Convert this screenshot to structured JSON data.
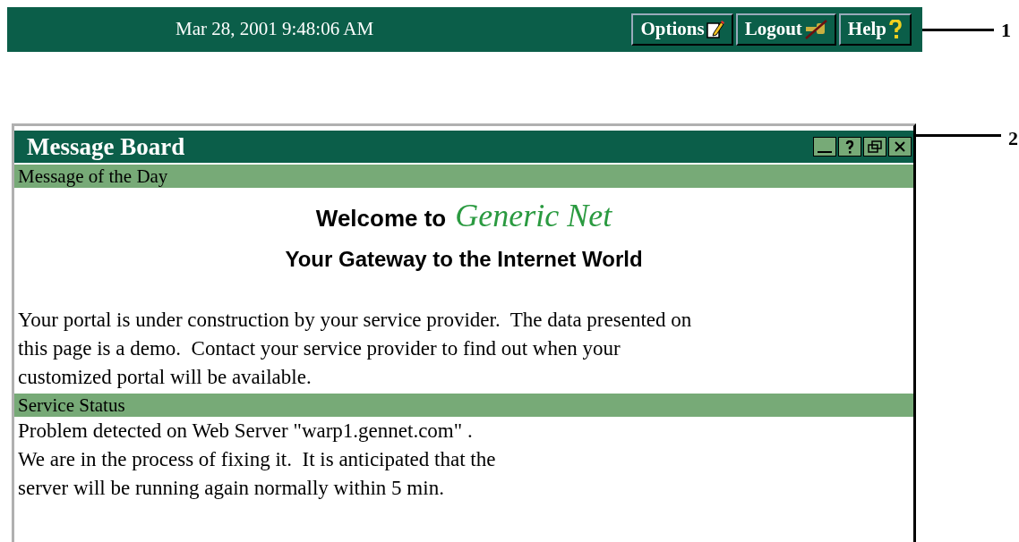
{
  "top_bar": {
    "datetime": "Mar 28, 2001 9:48:06 AM",
    "buttons": [
      {
        "label": "Options",
        "kind": "options"
      },
      {
        "label": "Logout",
        "kind": "logout"
      },
      {
        "label": "Help",
        "kind": "help"
      }
    ],
    "callout": "1"
  },
  "message_board": {
    "title": "Message Board",
    "callout": "2",
    "sections": [
      {
        "heading": "Message of the Day",
        "welcome": "Welcome to",
        "brand": "Generic Net",
        "subtitle": "Your Gateway to the Internet World",
        "lines": [
          "Your portal is under construction by your service provider.  The data presented on",
          "this page is a demo.  Contact your service provider to find out when your",
          "customized portal will be available."
        ]
      },
      {
        "heading": "Service Status",
        "lines": [
          "Problem detected on Web Server \"warp1.gennet.com\" .",
          "We are in the process of fixing it.  It is anticipated that the",
          "server will be running again normally within 5 min."
        ]
      }
    ]
  }
}
